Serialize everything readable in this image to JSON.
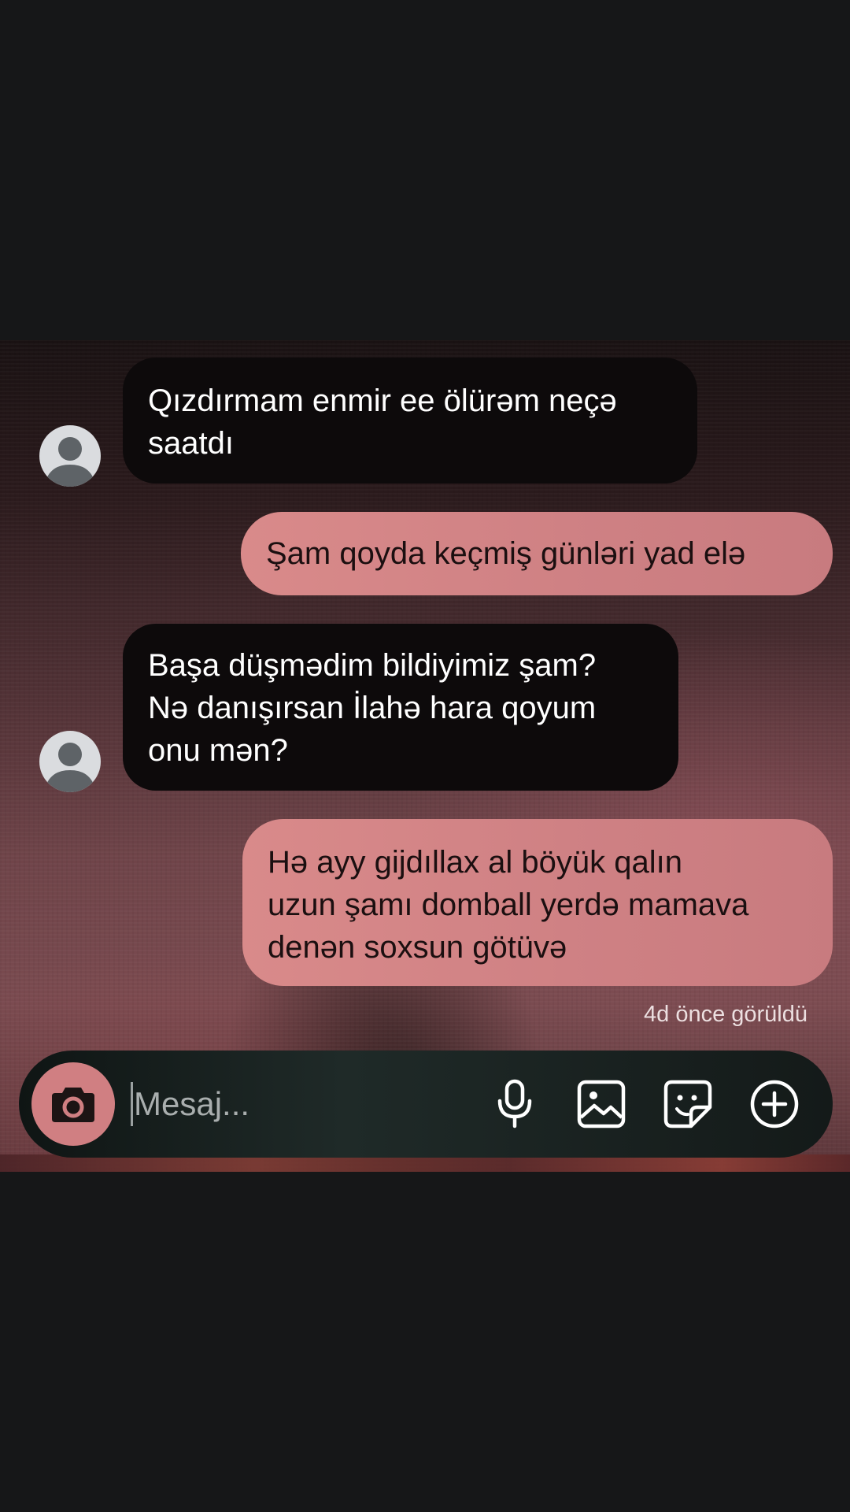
{
  "conversation": {
    "messages": [
      {
        "direction": "incoming",
        "text": "Qızdırmam enmir ee ölürəm neçə\nsaatdı"
      },
      {
        "direction": "outgoing",
        "text": "Şam qoyda keçmiş günləri yad elə"
      },
      {
        "direction": "incoming",
        "text": "Başa düşmədim bildiyimiz şam?\nNə danışırsan İlahə hara qoyum\nonu mən?"
      },
      {
        "direction": "outgoing",
        "text": "Hə ayy gijdıllax al böyük qalın\nuzun şamı domball yerdə mamava\ndenən soxsun götüvə"
      }
    ],
    "seen_status": "4d önce görüldü"
  },
  "composer": {
    "placeholder": "Mesaj...",
    "value": "",
    "icons": [
      "camera-icon",
      "microphone-icon",
      "gallery-icon",
      "sticker-icon",
      "plus-circle-icon"
    ]
  },
  "colors": {
    "page_background": "#161718",
    "incoming_bubble": "#0d0a0b",
    "outgoing_bubble": "#d38486",
    "camera_button": "#d07f82",
    "avatar": "#dadcdf"
  }
}
